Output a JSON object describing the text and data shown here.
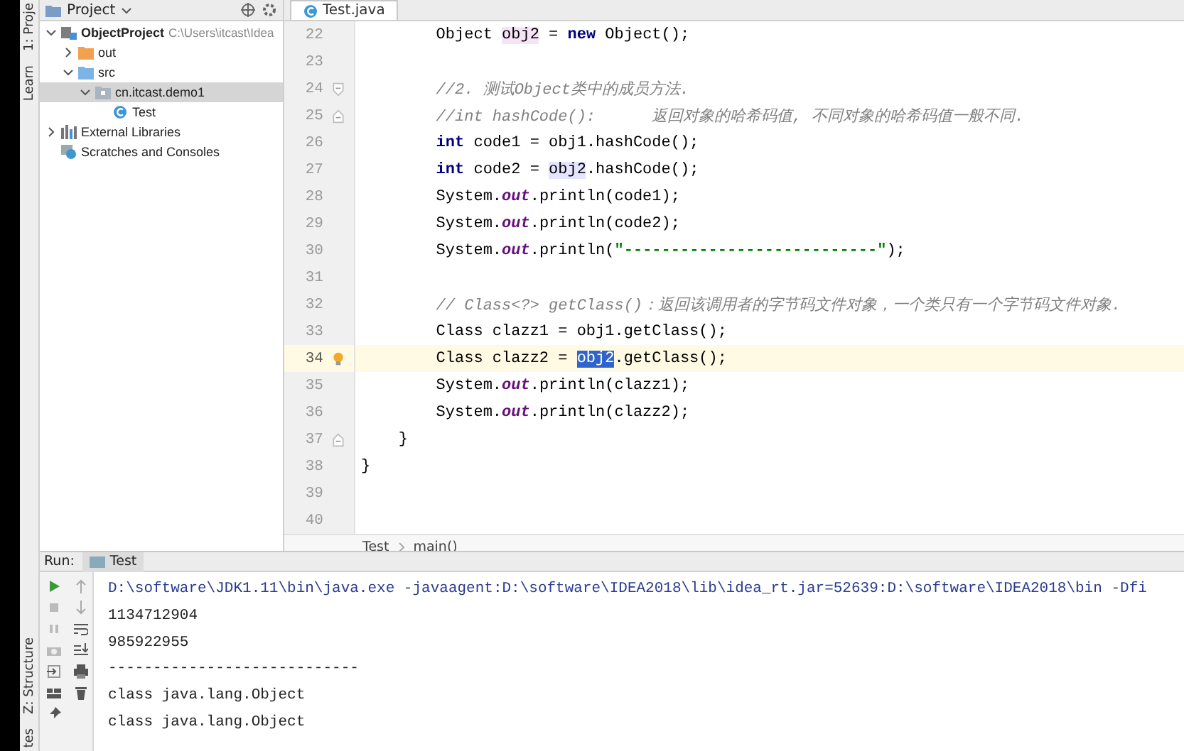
{
  "tool_strip": {
    "top_labels": [
      "1: Proje",
      "Learn"
    ],
    "bottom_labels": [
      "Z: Structure",
      "tes"
    ]
  },
  "project_panel": {
    "title": "Project",
    "tree": [
      {
        "label": "ObjectProject",
        "note": "C:\\Users\\itcast\\Idea",
        "kind": "module",
        "expanded": true,
        "selected": false,
        "children": [
          {
            "label": "out",
            "kind": "folder-orange",
            "expanded": false,
            "selected": false
          },
          {
            "label": "src",
            "kind": "folder-blue",
            "expanded": true,
            "selected": false,
            "children": [
              {
                "label": "cn.itcast.demo1",
                "kind": "package",
                "expanded": true,
                "selected": true,
                "children": [
                  {
                    "label": "Test",
                    "kind": "class",
                    "selected": false
                  }
                ]
              }
            ]
          }
        ]
      },
      {
        "label": "External Libraries",
        "kind": "library",
        "expanded": false,
        "selected": false
      },
      {
        "label": "Scratches and Consoles",
        "kind": "scratch",
        "selected": false
      }
    ]
  },
  "editor": {
    "tab": "Test.java",
    "lines": [
      {
        "number": "22",
        "kind": "plain",
        "current": false,
        "tokens": [
          {
            "kind": "text",
            "text": "        Object "
          },
          {
            "kind": "usage-write",
            "text": "obj2"
          },
          {
            "kind": "text",
            "text": " = "
          },
          {
            "kind": "keyword",
            "text": "new"
          },
          {
            "kind": "text",
            "text": " Object();"
          }
        ]
      },
      {
        "number": "23",
        "kind": "plain",
        "current": false
      },
      {
        "number": "24",
        "kind": "fold-start",
        "current": false,
        "tokens": [
          {
            "kind": "comment",
            "text": "        //2. 测试Object类中的成员方法."
          }
        ]
      },
      {
        "number": "25",
        "kind": "fold-end",
        "current": false,
        "tokens": [
          {
            "kind": "comment",
            "text": "        //int hashCode():      返回对象的哈希码值, 不同对象的哈希码值一般不同."
          }
        ]
      },
      {
        "number": "26",
        "kind": "plain",
        "current": false,
        "tokens": [
          {
            "kind": "keyword",
            "text": "        int"
          },
          {
            "kind": "text",
            "text": " code1 = obj1.hashCode();"
          }
        ]
      },
      {
        "number": "27",
        "kind": "plain",
        "current": false,
        "tokens": [
          {
            "kind": "keyword",
            "text": "        int"
          },
          {
            "kind": "text",
            "text": " code2 = "
          },
          {
            "kind": "usage-read",
            "text": "obj2"
          },
          {
            "kind": "text",
            "text": ".hashCode();"
          }
        ]
      },
      {
        "number": "28",
        "kind": "plain",
        "current": false,
        "tokens": [
          {
            "kind": "text",
            "text": "        System."
          },
          {
            "kind": "static-field",
            "text": "out"
          },
          {
            "kind": "text",
            "text": ".println(code1);"
          }
        ]
      },
      {
        "number": "29",
        "kind": "plain",
        "current": false,
        "tokens": [
          {
            "kind": "text",
            "text": "        System."
          },
          {
            "kind": "static-field",
            "text": "out"
          },
          {
            "kind": "text",
            "text": ".println(code2);"
          }
        ]
      },
      {
        "number": "30",
        "kind": "plain",
        "current": false,
        "tokens": [
          {
            "kind": "text",
            "text": "        System."
          },
          {
            "kind": "static-field",
            "text": "out"
          },
          {
            "kind": "text",
            "text": ".println("
          },
          {
            "kind": "string",
            "text": "\"---------------------------\""
          },
          {
            "kind": "text",
            "text": ");"
          }
        ]
      },
      {
        "number": "31",
        "kind": "plain",
        "current": false
      },
      {
        "number": "32",
        "kind": "plain",
        "current": false,
        "tokens": [
          {
            "kind": "comment",
            "text": "        // Class<?> getClass()：返回该调用者的字节码文件对象，一个类只有一个字节码文件对象."
          }
        ]
      },
      {
        "number": "33",
        "kind": "plain",
        "current": false,
        "tokens": [
          {
            "kind": "text",
            "text": "        Class clazz1 = obj1.getClass();"
          }
        ]
      },
      {
        "number": "34",
        "kind": "bulb",
        "current": true,
        "tokens": [
          {
            "kind": "text",
            "text": "        Class clazz2 = "
          },
          {
            "kind": "selection",
            "text": "obj2"
          },
          {
            "kind": "text",
            "text": ".getClass();"
          }
        ]
      },
      {
        "number": "35",
        "kind": "plain",
        "current": false,
        "tokens": [
          {
            "kind": "text",
            "text": "        System."
          },
          {
            "kind": "static-field",
            "text": "out"
          },
          {
            "kind": "text",
            "text": ".println(clazz1);"
          }
        ]
      },
      {
        "number": "36",
        "kind": "plain",
        "current": false,
        "tokens": [
          {
            "kind": "text",
            "text": "        System."
          },
          {
            "kind": "static-field",
            "text": "out"
          },
          {
            "kind": "text",
            "text": ".println(clazz2);"
          }
        ]
      },
      {
        "number": "37",
        "kind": "fold-end",
        "current": false,
        "tokens": [
          {
            "kind": "text",
            "text": "    }"
          }
        ]
      },
      {
        "number": "38",
        "kind": "plain",
        "current": false,
        "tokens": [
          {
            "kind": "text",
            "text": "}"
          }
        ]
      },
      {
        "number": "39",
        "kind": "plain",
        "current": false
      },
      {
        "number": "40",
        "kind": "plain",
        "current": false
      }
    ],
    "breadcrumb": [
      "Test",
      "main()"
    ]
  },
  "run_panel": {
    "label": "Run:",
    "tab": "Test",
    "output": [
      {
        "kind": "command",
        "text": "D:\\software\\JDK1.11\\bin\\java.exe -javaagent:D:\\software\\IDEA2018\\lib\\idea_rt.jar=52639:D:\\software\\IDEA2018\\bin -Dfi"
      },
      {
        "kind": "output",
        "text": "1134712904"
      },
      {
        "kind": "output",
        "text": "985922955"
      },
      {
        "kind": "output",
        "text": "----------------------------"
      },
      {
        "kind": "output",
        "text": "class java.lang.Object"
      },
      {
        "kind": "output",
        "text": "class java.lang.Object"
      }
    ]
  }
}
